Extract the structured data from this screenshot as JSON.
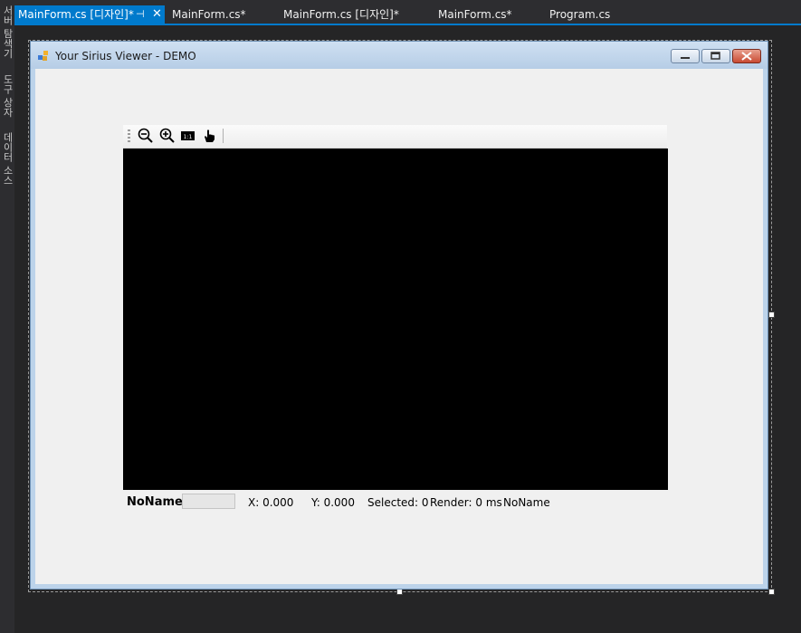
{
  "side_panel": {
    "tabs": [
      "서버 탐색기",
      "도구 상자",
      "데이터 소스"
    ]
  },
  "editor_tabs": [
    {
      "label": "MainForm.cs [디자인]*",
      "active": true
    },
    {
      "label": "MainForm.cs*",
      "active": false
    },
    {
      "label": "MainForm.cs [디자인]*",
      "active": false
    },
    {
      "label": "MainForm.cs*",
      "active": false
    },
    {
      "label": "Program.cs",
      "active": false
    }
  ],
  "form": {
    "title": "Your Sirius Viewer - DEMO",
    "toolbar_icons": [
      "zoom-out-icon",
      "zoom-in-icon",
      "actual-size-icon",
      "pan-hand-icon"
    ],
    "status": {
      "name": "NoName",
      "x": "X: 0.000",
      "y": "Y: 0.000",
      "selected": "Selected: 0",
      "render": "Render: 0 ms",
      "document": "NoName"
    }
  },
  "colors": {
    "accent": "#007acc",
    "ide_background": "#252526",
    "form_client": "#f0f0f0",
    "canvas": "#000000"
  }
}
